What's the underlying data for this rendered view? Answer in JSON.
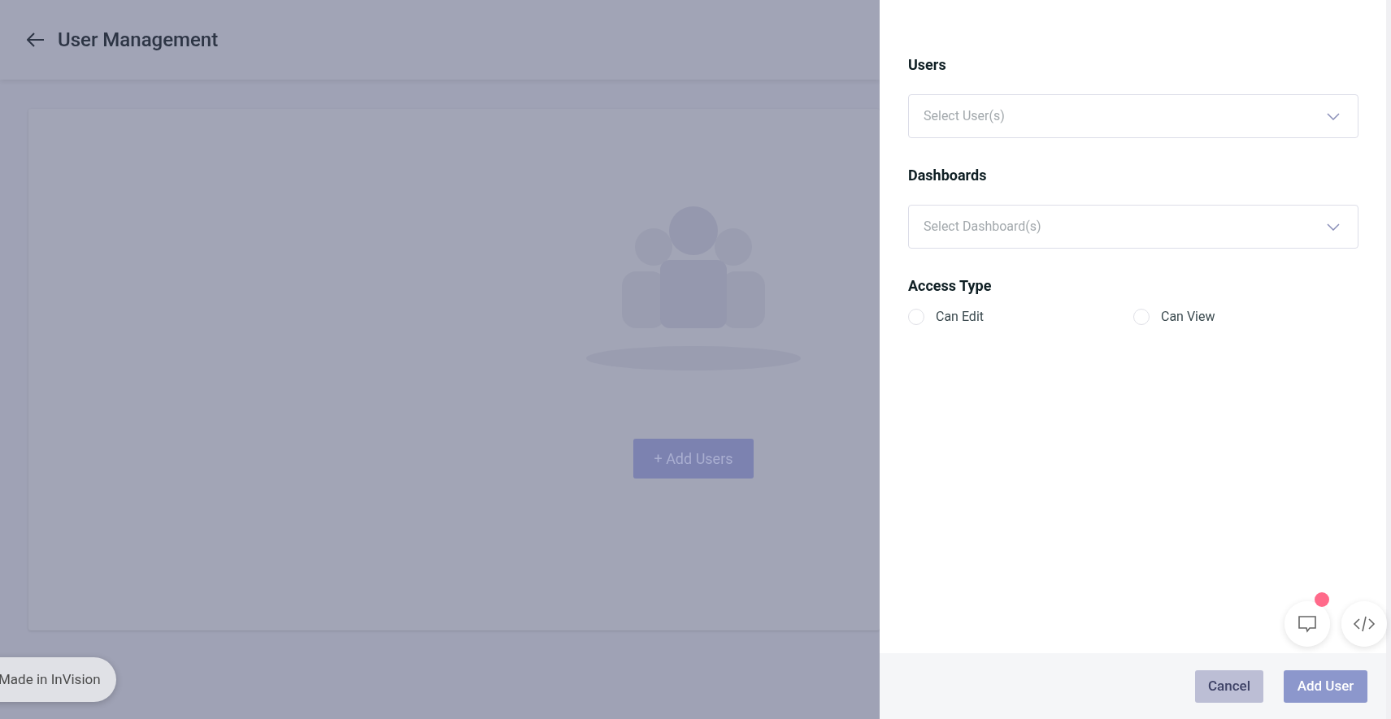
{
  "header": {
    "title": "User Management"
  },
  "empty_state": {
    "button": "+ Add Users"
  },
  "panel": {
    "sections": [
      {
        "kind": "select",
        "label": "Users",
        "placeholder": "Select User(s)"
      },
      {
        "kind": "select",
        "label": "Dashboards",
        "placeholder": "Select Dashboard(s)"
      },
      {
        "kind": "radio",
        "label": "Access Type",
        "options": [
          {
            "label": "Can Edit",
            "selected": false
          },
          {
            "label": "Can View",
            "selected": false
          }
        ]
      }
    ],
    "footer": {
      "cancel": "Cancel",
      "submit": "Add User"
    }
  },
  "badge": {
    "label": "Made in InVision"
  },
  "floating": {
    "comments_unread": true
  }
}
